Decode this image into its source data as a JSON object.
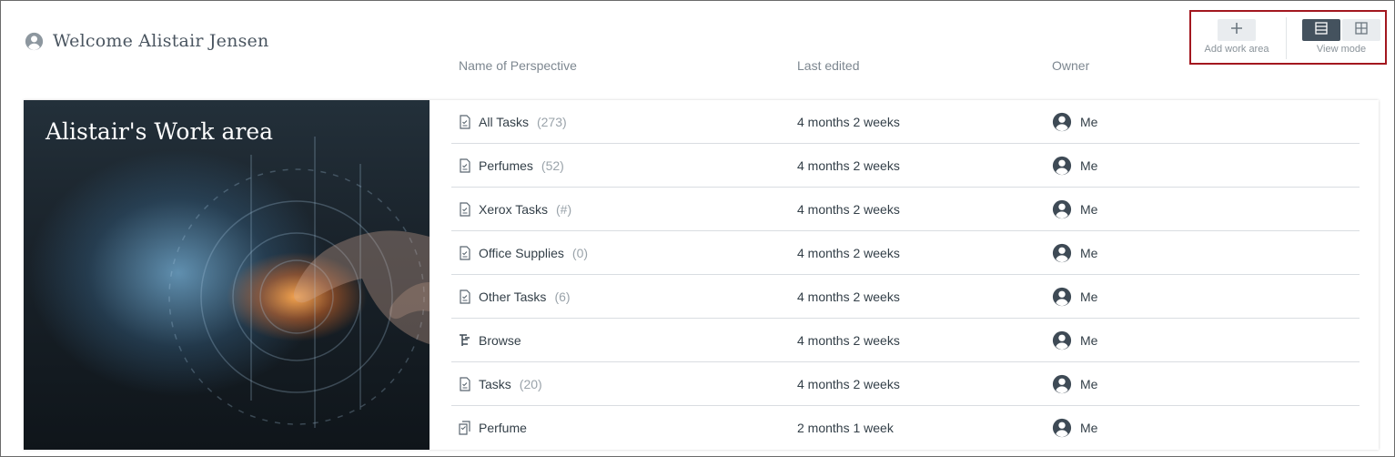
{
  "header": {
    "welcome": "Welcome Alistair Jensen",
    "avatar_icon": "user-circle-icon"
  },
  "columns": {
    "name": "Name of Perspective",
    "last_edited": "Last edited",
    "owner": "Owner"
  },
  "toolbar": {
    "add_work_area_label": "Add work area",
    "view_mode_label": "View mode",
    "view_modes": [
      "list",
      "grid"
    ],
    "active_view_mode": "list"
  },
  "work_area": {
    "title": "Alistair's Work area"
  },
  "perspectives": [
    {
      "name": "All Tasks",
      "count": "(273)",
      "icon": "document-icon",
      "last_edited": "4 months 2 weeks",
      "owner": "Me"
    },
    {
      "name": "Perfumes",
      "count": "(52)",
      "icon": "document-icon",
      "last_edited": "4 months 2 weeks",
      "owner": "Me"
    },
    {
      "name": "Xerox Tasks",
      "count": "(#)",
      "icon": "document-icon",
      "last_edited": "4 months 2 weeks",
      "owner": "Me"
    },
    {
      "name": "Office Supplies",
      "count": "(0)",
      "icon": "document-icon",
      "last_edited": "4 months 2 weeks",
      "owner": "Me"
    },
    {
      "name": "Other Tasks",
      "count": "(6)",
      "icon": "document-icon",
      "last_edited": "4 months 2 weeks",
      "owner": "Me"
    },
    {
      "name": "Browse",
      "count": "",
      "icon": "tree-icon",
      "last_edited": "4 months 2 weeks",
      "owner": "Me"
    },
    {
      "name": "Tasks",
      "count": "(20)",
      "icon": "document-icon",
      "last_edited": "4 months 2 weeks",
      "owner": "Me"
    },
    {
      "name": "Perfume",
      "count": "",
      "icon": "stacked-documents-icon",
      "last_edited": "2 months 1 week",
      "owner": "Me"
    }
  ],
  "colors": {
    "accent_dark": "#44525e",
    "highlight_border": "#a3171f",
    "muted_text": "#7d8790"
  }
}
